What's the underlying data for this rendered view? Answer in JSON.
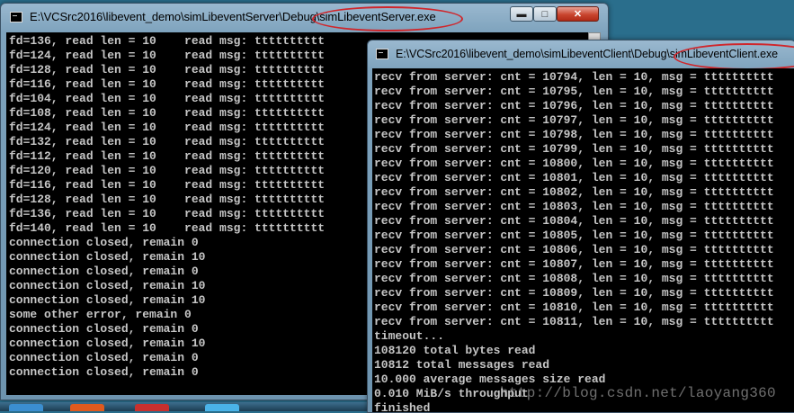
{
  "server_window": {
    "title": "E:\\VCSrc2016\\libevent_demo\\simLibeventServer\\Debug\\simLibeventServer.exe",
    "controls": {
      "minimize": "▬",
      "maximize": "□",
      "close": "✕"
    },
    "lines": [
      "fd=136, read len = 10    read msg: tttttttttt",
      "fd=124, read len = 10    read msg: tttttttttt",
      "fd=128, read len = 10    read msg: tttttttttt",
      "fd=116, read len = 10    read msg: tttttttttt",
      "fd=104, read len = 10    read msg: tttttttttt",
      "fd=108, read len = 10    read msg: tttttttttt",
      "fd=124, read len = 10    read msg: tttttttttt",
      "fd=132, read len = 10    read msg: tttttttttt",
      "fd=112, read len = 10    read msg: tttttttttt",
      "fd=120, read len = 10    read msg: tttttttttt",
      "fd=116, read len = 10    read msg: tttttttttt",
      "fd=128, read len = 10    read msg: tttttttttt",
      "fd=136, read len = 10    read msg: tttttttttt",
      "fd=140, read len = 10    read msg: tttttttttt",
      "connection closed, remain 0",
      "connection closed, remain 10",
      "connection closed, remain 0",
      "connection closed, remain 10",
      "connection closed, remain 10",
      "some other error, remain 0",
      "connection closed, remain 0",
      "connection closed, remain 10",
      "connection closed, remain 0",
      "connection closed, remain 0"
    ]
  },
  "client_window": {
    "title": "E:\\VCSrc2016\\libevent_demo\\simLibeventClient\\Debug\\simLibeventClient.exe",
    "lines": [
      "recv from server: cnt = 10794, len = 10, msg = tttttttttt",
      "recv from server: cnt = 10795, len = 10, msg = tttttttttt",
      "recv from server: cnt = 10796, len = 10, msg = tttttttttt",
      "recv from server: cnt = 10797, len = 10, msg = tttttttttt",
      "recv from server: cnt = 10798, len = 10, msg = tttttttttt",
      "recv from server: cnt = 10799, len = 10, msg = tttttttttt",
      "recv from server: cnt = 10800, len = 10, msg = tttttttttt",
      "recv from server: cnt = 10801, len = 10, msg = tttttttttt",
      "recv from server: cnt = 10802, len = 10, msg = tttttttttt",
      "recv from server: cnt = 10803, len = 10, msg = tttttttttt",
      "recv from server: cnt = 10804, len = 10, msg = tttttttttt",
      "recv from server: cnt = 10805, len = 10, msg = tttttttttt",
      "recv from server: cnt = 10806, len = 10, msg = tttttttttt",
      "recv from server: cnt = 10807, len = 10, msg = tttttttttt",
      "recv from server: cnt = 10808, len = 10, msg = tttttttttt",
      "recv from server: cnt = 10809, len = 10, msg = tttttttttt",
      "recv from server: cnt = 10810, len = 10, msg = tttttttttt",
      "recv from server: cnt = 10811, len = 10, msg = tttttttttt",
      "timeout...",
      "108120 total bytes read",
      "10812 total messages read",
      "10.000 average messages size read",
      "0.010 MiB/s throughput",
      "finished"
    ]
  },
  "watermark": "http://blog.csdn.net/laoyang360",
  "colors": {
    "console_text": "#c6c6c6",
    "annotation": "#d0262b"
  }
}
